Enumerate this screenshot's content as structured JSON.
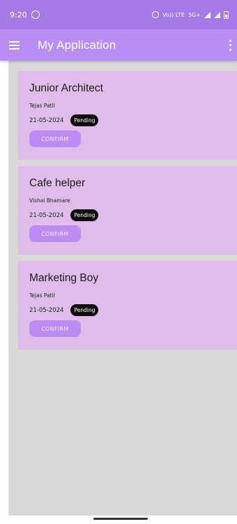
{
  "status_bar": {
    "time": "9:20",
    "icons": [
      "whatsapp-icon",
      "alarm-icon",
      "volte-icon",
      "signal-5g-icon",
      "signal-icon",
      "battery-icon"
    ],
    "volte_text": "Vo)) LTE",
    "network_text": "5G+"
  },
  "app_bar": {
    "title": "My Application",
    "menu_icon": "hamburger-menu-icon",
    "overflow_icon": "more-vert-icon",
    "background": "#b98df2"
  },
  "applications": [
    {
      "title": "Junior Architect",
      "name": "Tejas Patil",
      "date": "21-05-2024",
      "status": "Pending",
      "button": "CONFIRM"
    },
    {
      "title": "Cafe helper",
      "name": "Vishal Bhamare",
      "date": "21-05-2024",
      "status": "Pending",
      "button": "CONFIRM"
    },
    {
      "title": "Marketing Boy",
      "name": "Tejas Patil",
      "date": "21-05-2024",
      "status": "Pending",
      "button": "CONFIRM"
    }
  ],
  "colors": {
    "status_bar": "#a57ae6",
    "card_bg": "#dfbce9",
    "list_bg": "#d9d9d9",
    "button": "#bd8cf2",
    "badge": "#0d0d0d"
  }
}
